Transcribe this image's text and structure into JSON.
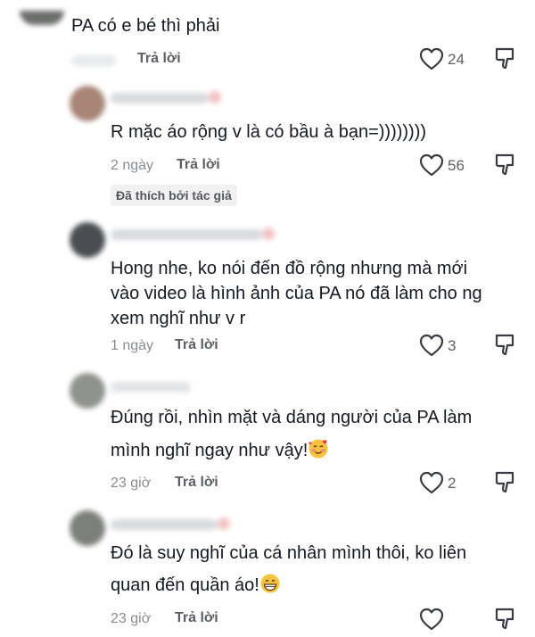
{
  "comments": [
    {
      "text": "PA có e bé thì phải",
      "time": "",
      "reply": "Trả lời",
      "likes": "24"
    },
    {
      "text": "R mặc áo rộng v là có bầu à bạn=))))))))",
      "time": "2 ngày",
      "reply": "Trả lời",
      "likes": "56",
      "badge": "Đã thích bởi tác giả"
    },
    {
      "lines": [
        "Hong nhe, ko nói đến đồ rộng nhưng mà mới",
        "vào video là hình ảnh của PA nó đã làm cho ng",
        "xem nghĩ như v r"
      ],
      "time": "1 ngày",
      "reply": "Trả lời",
      "likes": "3"
    },
    {
      "lines": [
        "Đúng rồi, nhìn mặt và dáng người của PA làm",
        "mình nghĩ ngay như vậy!"
      ],
      "emoji": "smiling-face-with-hearts",
      "time": "23 giờ",
      "reply": "Trả lời",
      "likes": "2"
    },
    {
      "lines": [
        "Đó là suy nghĩ của cá nhân mình thôi, ko liên",
        "quan đến quần áo!"
      ],
      "emoji": "grinning-face",
      "time": "23 giờ",
      "reply": "Trả lời",
      "likes": ""
    }
  ],
  "icons": {
    "like": "heart-icon",
    "dislike": "dislike-icon"
  },
  "colors": {
    "text": "#161823",
    "meta": "#8a8b91",
    "badge_bg": "#f1f1f2"
  }
}
